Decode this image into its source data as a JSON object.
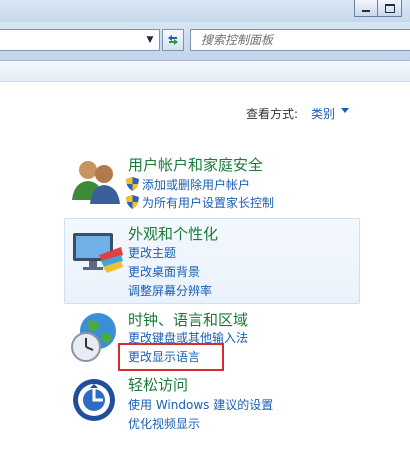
{
  "toolbar": {
    "search_placeholder": "搜索控制面板",
    "min_glyph": "",
    "max_glyph": ""
  },
  "view": {
    "label": "查看方式:",
    "value": "类别"
  },
  "categories": [
    {
      "title": "用户帐户和家庭安全",
      "links": [
        "添加或删除用户帐户",
        "为所有用户设置家长控制"
      ]
    },
    {
      "title": "外观和个性化",
      "links": [
        "更改主题",
        "更改桌面背景",
        "调整屏幕分辨率"
      ]
    },
    {
      "title": "时钟、语言和区域",
      "links": [
        "更改键盘或其他输入法",
        "更改显示语言"
      ]
    },
    {
      "title": "轻松访问",
      "links": [
        "使用 Windows 建议的设置",
        "优化视频显示"
      ]
    }
  ],
  "colors": {
    "link": "#1a5fb4",
    "category_title": "#1a7a3a",
    "highlight_box": "#d82b2b"
  }
}
